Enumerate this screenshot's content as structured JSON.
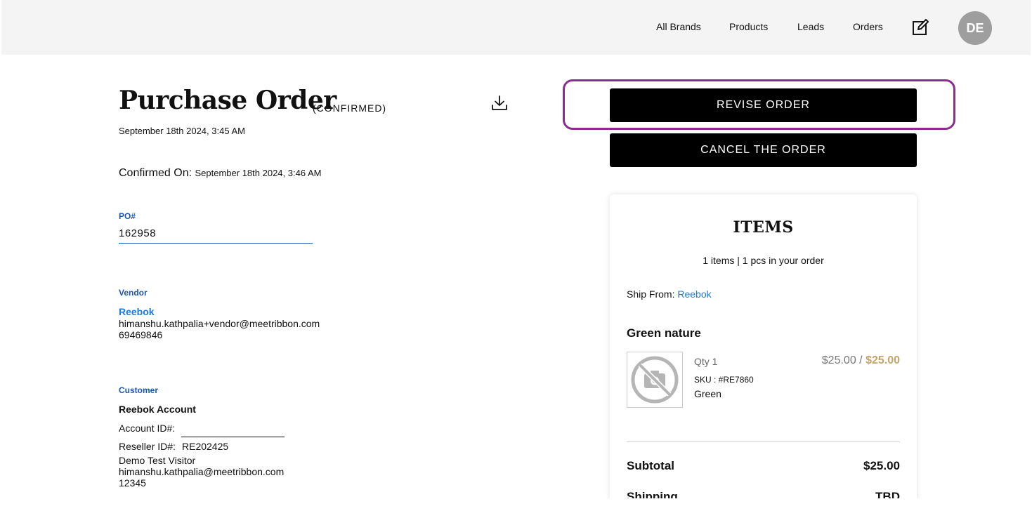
{
  "nav": {
    "links": [
      "All Brands",
      "Products",
      "Leads",
      "Orders"
    ],
    "edit_icon": "edit-icon",
    "avatar_initials": "DE"
  },
  "order": {
    "title": "Purchase Order",
    "status": "(CONFIRMED)",
    "created": "September 18th 2024, 3:45 AM",
    "confirmed_label": "Confirmed On:",
    "confirmed_on": "September 18th 2024, 3:46 AM",
    "po_label": "PO#",
    "po_number": "162958"
  },
  "vendor": {
    "label": "Vendor",
    "name": "Reebok",
    "email": "himanshu.kathpalia+vendor@meetribbon.com",
    "phone": "69469846"
  },
  "customer": {
    "label": "Customer",
    "account_name": "Reebok Account",
    "account_id_label": "Account ID#:",
    "reseller_id_label": "Reseller ID#:",
    "reseller_id": "RE202425",
    "contact_name": "Demo Test Visitor",
    "email": "himanshu.kathpalia@meetribbon.com",
    "phone": "12345"
  },
  "actions": {
    "revise": "REVISE ORDER",
    "cancel": "CANCEL THE ORDER"
  },
  "items": {
    "title": "ITEMS",
    "summary": "1 items | 1 pcs in your order",
    "ship_from_label": "Ship From:",
    "ship_from": "Reebok",
    "product": {
      "name": "Green nature",
      "qty": "Qty 1",
      "unit_price": "$25.00",
      "separator": " / ",
      "total_price": "$25.00",
      "sku": "SKU : #RE7860",
      "color": "Green"
    },
    "subtotal_label": "Subtotal",
    "subtotal": "$25.00",
    "shipping_label": "Shipping",
    "shipping": "TBD"
  },
  "colors": {
    "accent_blue": "#1a55b3",
    "link_blue": "#1a7be0",
    "highlight_purple": "#8a2d8e",
    "price_gold": "#c2a56a"
  }
}
